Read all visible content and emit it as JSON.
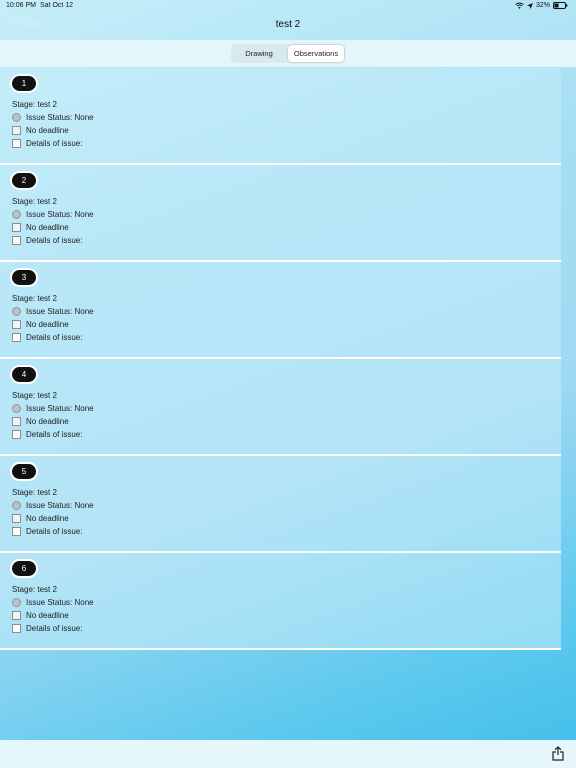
{
  "status": {
    "time": "10:06 PM",
    "date": "Sat Oct 12",
    "battery": "32%"
  },
  "nav": {
    "back_label": "Stages",
    "title": "test 2"
  },
  "segments": [
    {
      "label": "Drawing",
      "selected": false
    },
    {
      "label": "Observations",
      "selected": true
    }
  ],
  "observations": [
    {
      "number": "1",
      "stage": "Stage: test 2",
      "status": "Issue Status: None",
      "deadline": "No deadline",
      "details": "Details of issue:"
    },
    {
      "number": "2",
      "stage": "Stage: test 2",
      "status": "Issue Status: None",
      "deadline": "No deadline",
      "details": "Details of issue:"
    },
    {
      "number": "3",
      "stage": "Stage: test 2",
      "status": "Issue Status: None",
      "deadline": "No deadline",
      "details": "Details of issue:"
    },
    {
      "number": "4",
      "stage": "Stage: test 2",
      "status": "Issue Status: None",
      "deadline": "No deadline",
      "details": "Details of issue:"
    },
    {
      "number": "5",
      "stage": "Stage: test 2",
      "status": "Issue Status: None",
      "deadline": "No deadline",
      "details": "Details of issue:"
    },
    {
      "number": "6",
      "stage": "Stage: test 2",
      "status": "Issue Status: None",
      "deadline": "No deadline",
      "details": "Details of issue:"
    }
  ],
  "icons": {
    "back": "chevron-left-icon",
    "share": "share-icon",
    "status": "status-circle-icon",
    "deadline": "calendar-icon",
    "details": "document-icon",
    "disclosure": "chevron-right-icon"
  }
}
